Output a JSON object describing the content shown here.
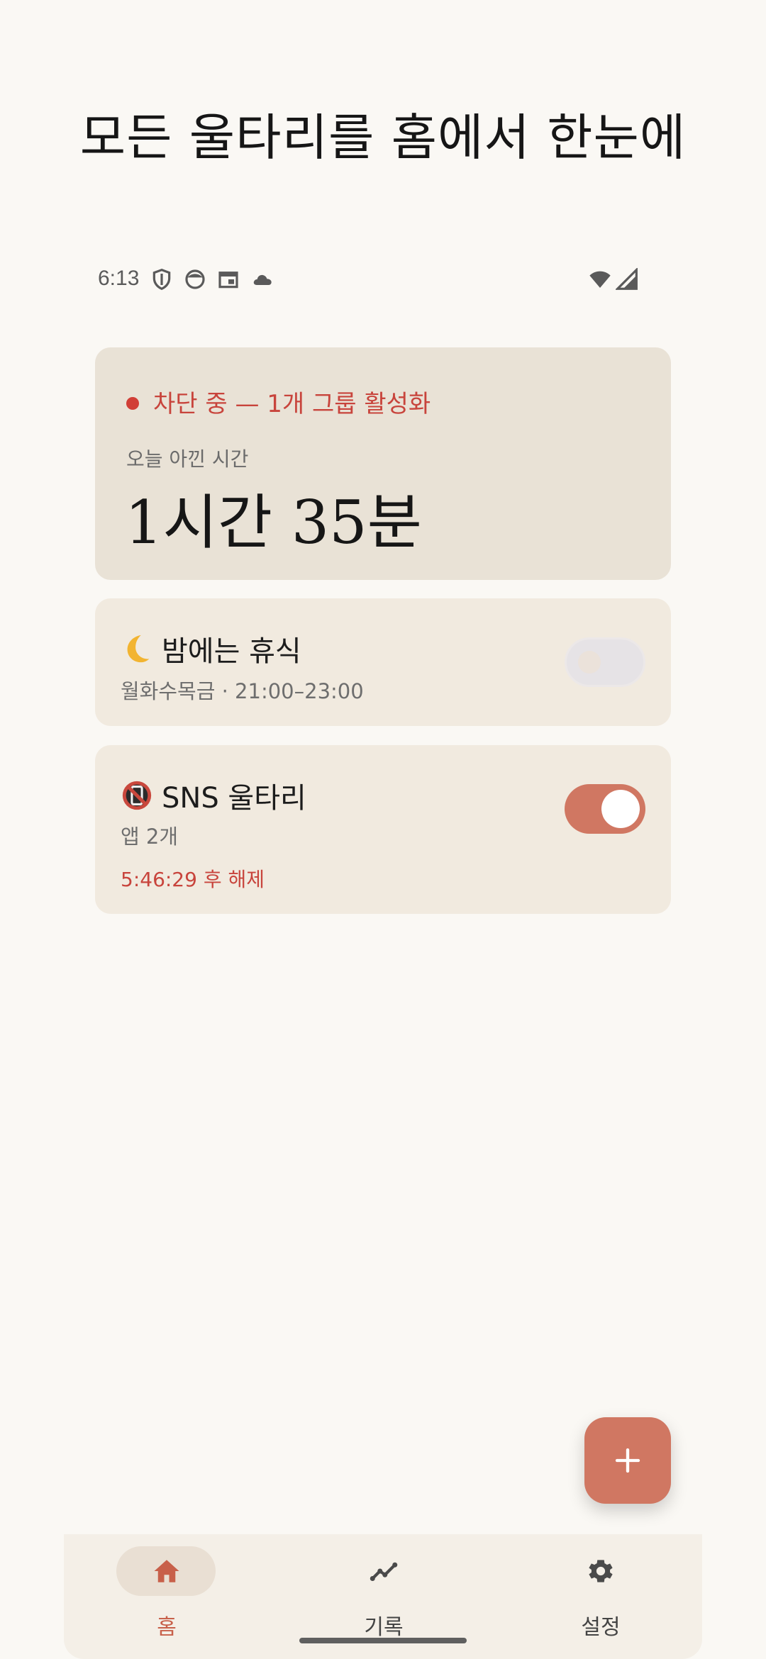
{
  "headline": "모든 울타리를 홈에서 한눈에",
  "status_bar": {
    "time": "6:13",
    "left_icons": [
      "shield-icon",
      "face-icon",
      "calendar-icon",
      "cloud-icon"
    ],
    "right_icons": [
      "wifi-icon",
      "signal-icon"
    ]
  },
  "summary": {
    "status_text": "차단 중 — 1개 그룹 활성화",
    "saved_label": "오늘 아낀 시간",
    "saved_value": "1시간 35분"
  },
  "groups": [
    {
      "icon": "crescent-moon-icon",
      "title": "밤에는 휴식",
      "subtitle": "월화수목금 · 21:00–23:00",
      "enabled": false
    },
    {
      "icon": "no-mobile-phone-icon",
      "title": "SNS 울타리",
      "subtitle": "앱 2개",
      "countdown": "5:46:29 후 해제",
      "enabled": true
    }
  ],
  "fab": {
    "icon": "plus-icon"
  },
  "bottom_nav": {
    "items": [
      {
        "label": "홈",
        "icon": "home-icon",
        "active": true
      },
      {
        "label": "기록",
        "icon": "trend-line-icon",
        "active": false
      },
      {
        "label": "설정",
        "icon": "gear-icon",
        "active": false
      }
    ]
  },
  "colors": {
    "accent": "#d07762",
    "alert_red": "#c8443c",
    "background": "#faf8f4",
    "summary_card": "#e9e2d6",
    "group_card": "#f1eadf"
  }
}
